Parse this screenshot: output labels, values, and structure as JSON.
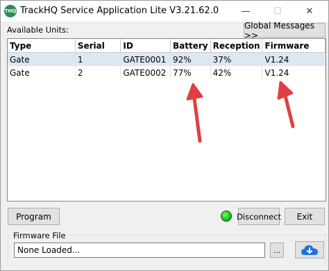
{
  "window": {
    "title": "TrackHQ Service Application Lite V3.21.62.0",
    "icon": "trackhq-app-icon",
    "icon_text": "THQ",
    "controls": {
      "minimize": "—",
      "maximize": "☐",
      "close": "✕"
    }
  },
  "units_panel": {
    "label": "Available Units:",
    "global_messages_label": "Global Messages >>",
    "columns": [
      "Type",
      "Serial",
      "ID",
      "Battery",
      "Reception",
      "Firmware"
    ],
    "rows": [
      [
        "Gate",
        "1",
        "GATE0001",
        "92%",
        "37%",
        "V1.24"
      ],
      [
        "Gate",
        "2",
        "GATE0002",
        "77%",
        "42%",
        "V1.24"
      ]
    ]
  },
  "actions": {
    "program_label": "Program",
    "status_color": "#12c012",
    "disconnect_label": "Disconnect",
    "exit_label": "Exit"
  },
  "firmware": {
    "group_label": "Firmware File",
    "file_value": "None Loaded...",
    "browse_label": "...",
    "cloud_icon": "cloud-download-icon"
  },
  "colors": {
    "annotation_arrow": "#e04040",
    "selected_row": "#dde8f5",
    "cloud_blue": "#1e73d8"
  }
}
